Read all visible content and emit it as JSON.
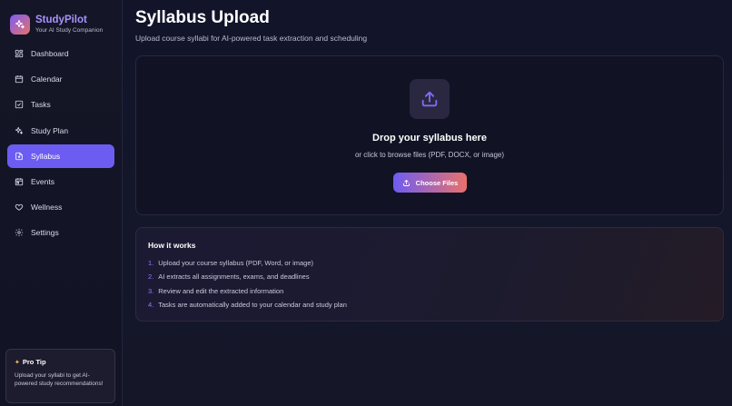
{
  "brand": {
    "name": "StudyPilot",
    "tagline": "Your AI Study Companion"
  },
  "sidebar": {
    "items": [
      {
        "label": "Dashboard",
        "icon": "dashboard-icon",
        "active": false
      },
      {
        "label": "Calendar",
        "icon": "calendar-icon",
        "active": false
      },
      {
        "label": "Tasks",
        "icon": "checkbox-icon",
        "active": false
      },
      {
        "label": "Study Plan",
        "icon": "sparkles-icon",
        "active": false
      },
      {
        "label": "Syllabus",
        "icon": "document-icon",
        "active": true
      },
      {
        "label": "Events",
        "icon": "calendar-event-icon",
        "active": false
      },
      {
        "label": "Wellness",
        "icon": "heart-icon",
        "active": false
      },
      {
        "label": "Settings",
        "icon": "gear-icon",
        "active": false
      }
    ],
    "tip": {
      "title": "Pro Tip",
      "text": "Upload your syllabi to get AI-powered study recommendations!"
    }
  },
  "main": {
    "title": "Syllabus Upload",
    "subtitle": "Upload course syllabi for AI-powered task extraction and scheduling",
    "dropzone": {
      "title": "Drop your syllabus here",
      "subtitle": "or click to browse files (PDF, DOCX, or image)",
      "button_label": "Choose Files"
    },
    "how_it_works": {
      "title": "How it works",
      "steps": [
        {
          "num": "1.",
          "text": "Upload your course syllabus (PDF, Word, or image)"
        },
        {
          "num": "2.",
          "text": "AI extracts all assignments, exams, and deadlines"
        },
        {
          "num": "3.",
          "text": "Review and edit the extracted information"
        },
        {
          "num": "4.",
          "text": "Tasks are automatically added to your calendar and study plan"
        }
      ]
    }
  },
  "colors": {
    "accent": "#6d5cf2",
    "brand_text": "#a892ff",
    "gradient_start": "#6e5cf3",
    "gradient_end": "#e8716b"
  }
}
